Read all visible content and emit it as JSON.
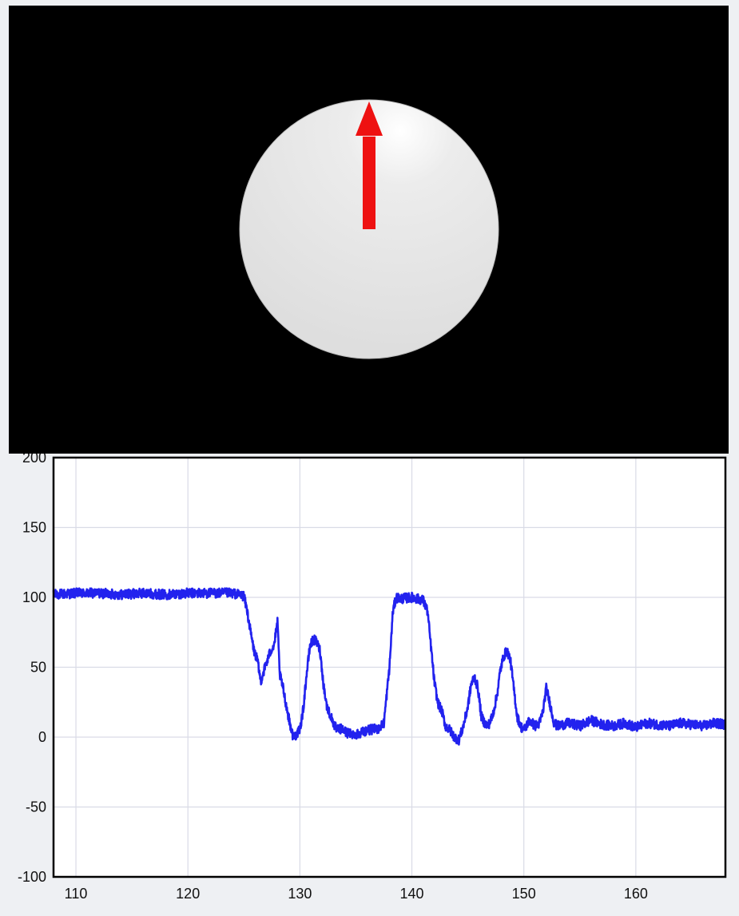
{
  "visualization": {
    "background_color": "#000000",
    "sphere_color": "#e4e4e4",
    "arrow_color": "#ee1111",
    "arrow_direction": "up"
  },
  "chart_data": {
    "type": "line",
    "title": "",
    "xlabel": "",
    "ylabel": "",
    "xlim": [
      108,
      168
    ],
    "ylim": [
      -100,
      200
    ],
    "x_ticks": [
      110,
      120,
      130,
      140,
      150,
      160
    ],
    "y_ticks": [
      200,
      150,
      100,
      50,
      0,
      -50,
      -100
    ],
    "grid": true,
    "line_color": "#2222ee",
    "series": [
      {
        "x": [
          108,
          110,
          112,
          114,
          116,
          118,
          120,
          122,
          124,
          125,
          125.3,
          125.6,
          125.9,
          126.2,
          126.5,
          126.8,
          127.1,
          127.4,
          127.7,
          128.0,
          128.2,
          128.5,
          128.8,
          129.1,
          129.4,
          129.7,
          130.0,
          130.3,
          130.6,
          130.9,
          131.2,
          131.5,
          131.8,
          132.1,
          132.4,
          132.7,
          133.0,
          133.3,
          133.7,
          134.2,
          135,
          136,
          137,
          137.5,
          138.0,
          138.3,
          138.6,
          139,
          140,
          141,
          141.4,
          141.7,
          142.0,
          142.3,
          142.7,
          143.0,
          143.4,
          143.8,
          144.2,
          144.6,
          145.0,
          145.3,
          145.6,
          145.9,
          146.2,
          146.5,
          146.8,
          147.2,
          147.6,
          147.9,
          148.2,
          148.5,
          148.8,
          149.1,
          149.4,
          149.7,
          150.0,
          150.5,
          151.0,
          151.4,
          151.7,
          152.0,
          152.3,
          152.7,
          153,
          154,
          155,
          156,
          157,
          158,
          159,
          160,
          161,
          162,
          163,
          164,
          165,
          166,
          167,
          168
        ],
        "y": [
          102,
          103,
          103,
          102,
          103,
          102,
          103,
          103,
          103,
          101,
          90,
          75,
          62,
          55,
          40,
          48,
          55,
          62,
          66,
          82,
          45,
          35,
          22,
          10,
          0,
          2,
          5,
          20,
          45,
          65,
          70,
          68,
          62,
          38,
          22,
          16,
          10,
          5,
          6,
          3,
          2,
          5,
          6,
          10,
          50,
          90,
          100,
          99,
          100,
          98,
          90,
          65,
          40,
          25,
          18,
          8,
          5,
          0,
          -2,
          8,
          22,
          38,
          43,
          35,
          15,
          10,
          8,
          15,
          30,
          48,
          58,
          62,
          55,
          35,
          15,
          8,
          5,
          12,
          8,
          10,
          18,
          35,
          25,
          10,
          8,
          10,
          8,
          12,
          9,
          8,
          10,
          7,
          10,
          9,
          8,
          10,
          9,
          8,
          10,
          9
        ]
      }
    ]
  }
}
